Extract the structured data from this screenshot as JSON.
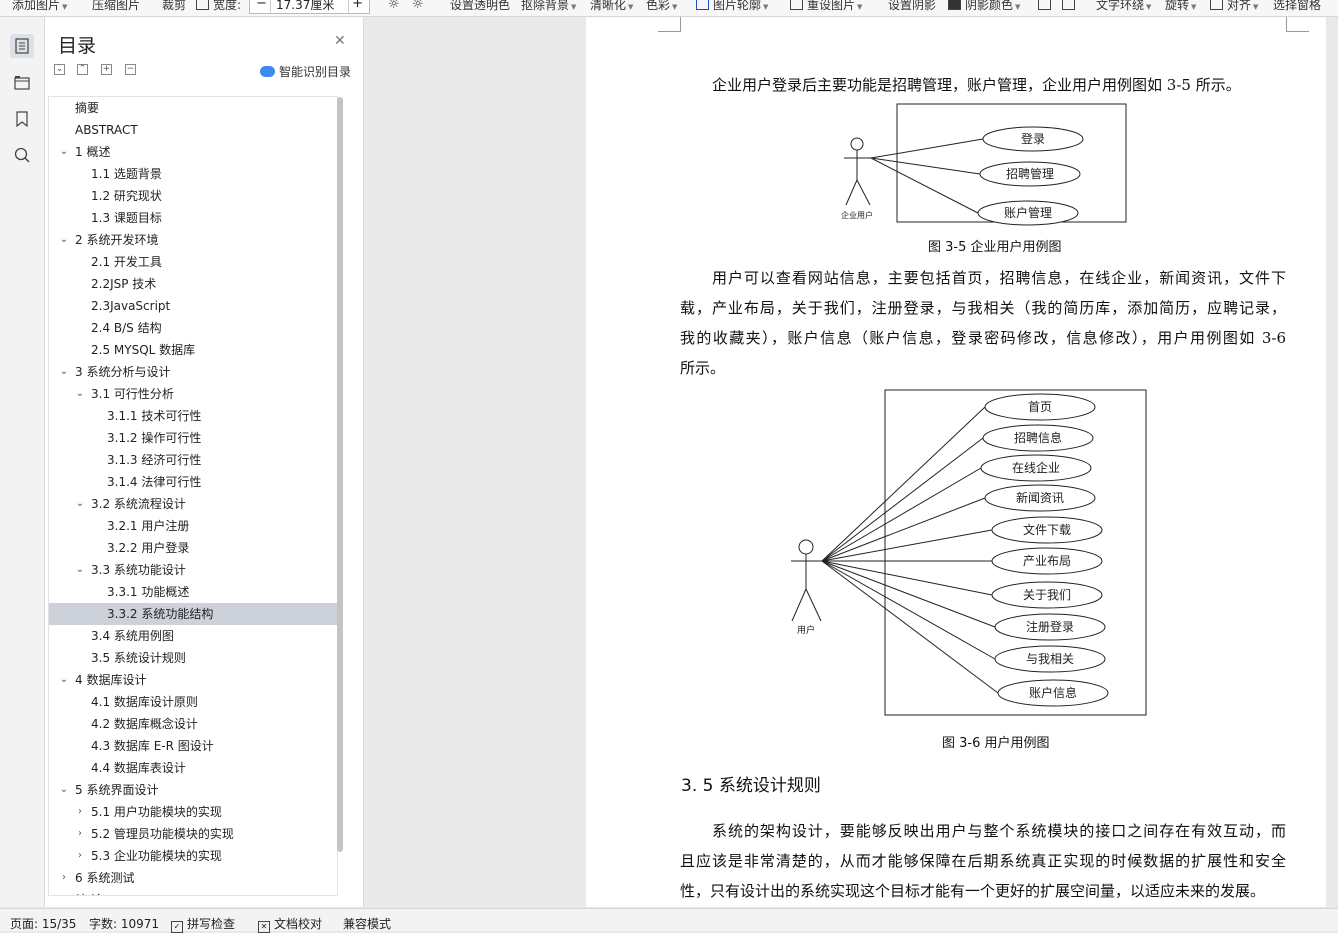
{
  "toolbar": {
    "add_image": "添加图片",
    "compress": "压缩图片",
    "crop": "裁剪",
    "width_label": "宽度:",
    "width_value": "17.37厘米",
    "transparent": "设置透明色",
    "remove_bg": "抠除背景",
    "sharpen": "清晰化",
    "color": "色彩",
    "outline": "图片轮廓",
    "reset": "重设图片",
    "shadow": "设置阴影",
    "shadow_color": "阴影颜色",
    "text_wrap": "文字环绕",
    "rotate": "旋转",
    "align": "对齐",
    "select_pane": "选择窗格"
  },
  "toc": {
    "title": "目录",
    "smart": "智能识别目录",
    "items": [
      {
        "label": "摘要",
        "level": 0,
        "chevron": ""
      },
      {
        "label": "ABSTRACT",
        "level": 0,
        "chevron": ""
      },
      {
        "label": "1 概述",
        "level": 0,
        "chevron": "down"
      },
      {
        "label": "1.1 选题背景",
        "level": 1,
        "chevron": ""
      },
      {
        "label": "1.2 研究现状",
        "level": 1,
        "chevron": ""
      },
      {
        "label": "1.3 课题目标",
        "level": 1,
        "chevron": ""
      },
      {
        "label": "2 系统开发环境",
        "level": 0,
        "chevron": "down"
      },
      {
        "label": "2.1 开发工具",
        "level": 1,
        "chevron": ""
      },
      {
        "label": "2.2JSP 技术",
        "level": 1,
        "chevron": ""
      },
      {
        "label": "2.3JavaScript",
        "level": 1,
        "chevron": ""
      },
      {
        "label": "2.4 B/S 结构",
        "level": 1,
        "chevron": ""
      },
      {
        "label": "2.5 MYSQL 数据库",
        "level": 1,
        "chevron": ""
      },
      {
        "label": "3 系统分析与设计",
        "level": 0,
        "chevron": "down"
      },
      {
        "label": "3.1 可行性分析",
        "level": 1,
        "chevron": "down"
      },
      {
        "label": "3.1.1 技术可行性",
        "level": 2,
        "chevron": ""
      },
      {
        "label": "3.1.2 操作可行性",
        "level": 2,
        "chevron": ""
      },
      {
        "label": "3.1.3 经济可行性",
        "level": 2,
        "chevron": ""
      },
      {
        "label": "3.1.4 法律可行性",
        "level": 2,
        "chevron": ""
      },
      {
        "label": "3.2 系统流程设计",
        "level": 1,
        "chevron": "down"
      },
      {
        "label": "3.2.1 用户注册",
        "level": 2,
        "chevron": ""
      },
      {
        "label": "3.2.2 用户登录",
        "level": 2,
        "chevron": ""
      },
      {
        "label": "3.3 系统功能设计",
        "level": 1,
        "chevron": "down"
      },
      {
        "label": "3.3.1 功能概述",
        "level": 2,
        "chevron": ""
      },
      {
        "label": "3.3.2 系统功能结构",
        "level": 2,
        "chevron": "",
        "selected": true
      },
      {
        "label": "3.4 系统用例图",
        "level": 1,
        "chevron": ""
      },
      {
        "label": "3.5 系统设计规则",
        "level": 1,
        "chevron": ""
      },
      {
        "label": "4 数据库设计",
        "level": 0,
        "chevron": "down"
      },
      {
        "label": "4.1 数据库设计原则",
        "level": 1,
        "chevron": ""
      },
      {
        "label": "4.2 数据库概念设计",
        "level": 1,
        "chevron": ""
      },
      {
        "label": "4.3 数据库 E-R 图设计",
        "level": 1,
        "chevron": ""
      },
      {
        "label": "4.4 数据库表设计",
        "level": 1,
        "chevron": ""
      },
      {
        "label": "5 系统界面设计",
        "level": 0,
        "chevron": "down"
      },
      {
        "label": "5.1 用户功能模块的实现",
        "level": 1,
        "chevron": "right"
      },
      {
        "label": "5.2 管理员功能模块的实现",
        "level": 1,
        "chevron": "right"
      },
      {
        "label": "5.3 企业功能模块的实现",
        "level": 1,
        "chevron": "right"
      },
      {
        "label": "6 系统测试",
        "level": 0,
        "chevron": "right"
      },
      {
        "label": "结 论",
        "level": 0,
        "chevron": ""
      }
    ]
  },
  "doc": {
    "para1": "企业用户登录后主要功能是招聘管理，账户管理，企业用户用例图如 3-5 所示。",
    "diagram1": {
      "actor": "企业用户",
      "use_cases": [
        "登录",
        "招聘管理",
        "账户管理"
      ]
    },
    "caption1": "图 3-5 企业用户用例图",
    "para2_lines": [
      "用户可以查看网站信息，主要包括首页，招聘信息，在线企业，新闻资讯，文件下",
      "载，产业布局，关于我们，注册登录，与我相关（我的简历库，添加简历，应聘记录，",
      "我的收藏夹），账户信息（账户信息，登录密码修改，信息修改），用户用例图如 3-6",
      "所示。"
    ],
    "diagram2": {
      "actor": "用户",
      "use_cases": [
        "首页",
        "招聘信息",
        "在线企业",
        "新闻资讯",
        "文件下载",
        "产业布局",
        "关于我们",
        "注册登录",
        "与我相关",
        "账户信息"
      ]
    },
    "caption2": "图 3-6 用户用例图",
    "heading": "3. 5 系统设计规则",
    "para3_lines": [
      "系统的架构设计，要能够反映出用户与整个系统模块的接口之间存在有效互动，而",
      "且应该是非常清楚的，从而才能够保障在后期系统真正实现的时候数据的扩展性和安全",
      "性，只有设计出的系统实现这个目标才能有一个更好的扩展空间量，以适应未来的发展。"
    ]
  },
  "status": {
    "page": "页面: 15/35",
    "words": "字数: 10971",
    "spell": "拼写检查",
    "proof": "文档校对",
    "compat": "兼容模式"
  }
}
